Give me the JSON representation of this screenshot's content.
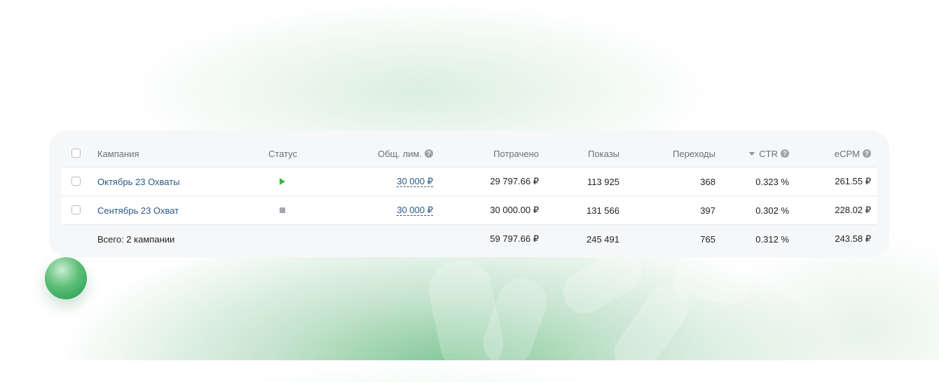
{
  "table": {
    "columns": {
      "campaign": "Кампания",
      "status": "Статус",
      "limit": "Общ. лим.",
      "spent": "Потрачено",
      "shows": "Показы",
      "clicks": "Переходы",
      "ctr": "CTR",
      "ecpm": "eCPM"
    },
    "sorted_column": "ctr",
    "rows": [
      {
        "name": "Октябрь 23 Охваты",
        "status": "running",
        "limit": "30 000 ₽",
        "spent": "29 797.66 ₽",
        "shows": "113 925",
        "clicks": "368",
        "ctr": "0.323 %",
        "ecpm": "261.55 ₽"
      },
      {
        "name": "Сентябрь 23 Охват",
        "status": "stopped",
        "limit": "30 000 ₽",
        "spent": "30 000.00 ₽",
        "shows": "131 566",
        "clicks": "397",
        "ctr": "0.302 %",
        "ecpm": "228.02 ₽"
      }
    ],
    "total": {
      "label": "Всего: 2 кампании",
      "spent": "59 797.66 ₽",
      "shows": "245 491",
      "clicks": "765",
      "ctr": "0.312 %",
      "ecpm": "243.58 ₽"
    }
  },
  "icons": {
    "help": "?",
    "status_running": "play-icon",
    "status_stopped": "stop-icon",
    "sort": "sort-desc-icon"
  },
  "colors": {
    "link": "#2a5885",
    "status_running": "#3db344",
    "status_stopped": "#a5a9af",
    "accent_green": "#239a4c"
  }
}
